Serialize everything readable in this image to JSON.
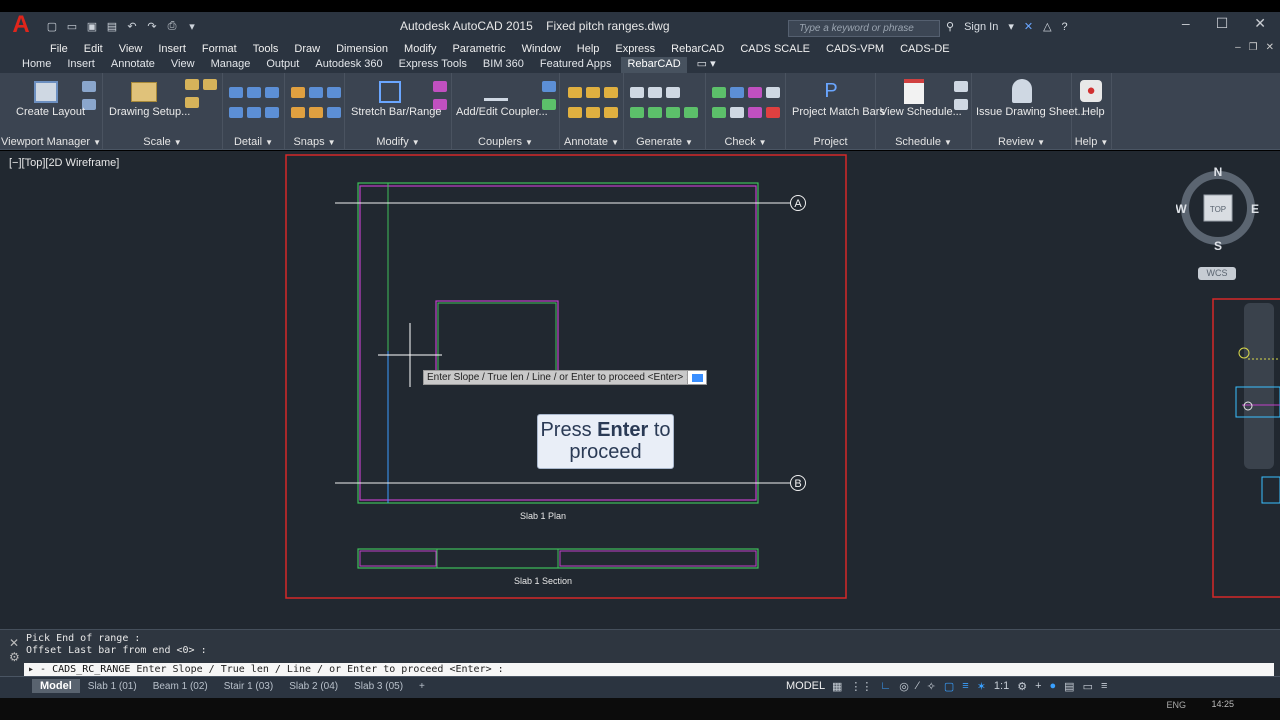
{
  "app": {
    "title": "Autodesk AutoCAD 2015",
    "document": "Fixed pitch ranges.dwg",
    "search_placeholder": "Type a keyword or phrase",
    "sign_in": "Sign In"
  },
  "menu": [
    "File",
    "Edit",
    "View",
    "Insert",
    "Format",
    "Tools",
    "Draw",
    "Dimension",
    "Modify",
    "Parametric",
    "Window",
    "Help",
    "Express",
    "RebarCAD",
    "CADS SCALE",
    "CADS-VPM",
    "CADS-DE"
  ],
  "ribbon_tabs": [
    "Home",
    "Insert",
    "Annotate",
    "View",
    "Manage",
    "Output",
    "Autodesk 360",
    "Express Tools",
    "BIM 360",
    "Featured Apps",
    "RebarCAD"
  ],
  "ribbon_active_tab": "RebarCAD",
  "ribbon": {
    "buttons": {
      "create_layout": "Create Layout",
      "drawing_setup": "Drawing Setup...",
      "stretch_bar": "Stretch Bar/Range",
      "add_edit_coupler": "Add/Edit Coupler...",
      "project_match_bars": "Project Match Bars",
      "view_schedule": "View Schedule...",
      "issue_drawing_sheet": "Issue Drawing Sheet...",
      "help": "Help"
    },
    "panels": {
      "viewport_manager": "Viewport Manager",
      "scale": "Scale",
      "detail": "Detail",
      "snaps": "Snaps",
      "modify": "Modify",
      "couplers": "Couplers",
      "annotate": "Annotate",
      "generate": "Generate",
      "check": "Check",
      "project": "Project",
      "schedule": "Schedule",
      "review": "Review",
      "help": "Help"
    }
  },
  "viewport": {
    "label": "[−][Top][2D Wireframe]",
    "prompt_tooltip": "Enter Slope / True len / Line / or Enter to proceed <Enter> :",
    "press_enter_prefix": "Press ",
    "press_enter_bold": "Enter",
    "press_enter_suffix": " to proceed",
    "plan_caption": "Slab 1 Plan",
    "section_caption": "Slab 1 Section",
    "grid_a": "A",
    "grid_b": "B",
    "compass": {
      "n": "N",
      "s": "S",
      "e": "E",
      "w": "W",
      "top": "TOP"
    },
    "wcs": "WCS"
  },
  "command_line": {
    "history": [
      "Pick End of range :",
      "Offset Last bar from end <0> :"
    ],
    "command": "CADS_RC_RANGE",
    "prompt": "Enter Slope / True len / Line / or Enter to proceed <Enter> :"
  },
  "status_bar": {
    "layout_tabs": [
      "Model",
      "Slab 1 (01)",
      "Beam 1 (02)",
      "Stair 1 (03)",
      "Slab 2 (04)",
      "Slab 3 (05)"
    ],
    "add_tab": "+",
    "model_button": "MODEL",
    "scale": "1:1"
  },
  "taskbar": {
    "lang": "ENG",
    "time": "14:25"
  },
  "colors": {
    "accent_blue": "#39a0ff",
    "drawing_magenta": "#c040c8",
    "drawing_green": "#3fbf5a",
    "sheet_border": "#d62828"
  }
}
